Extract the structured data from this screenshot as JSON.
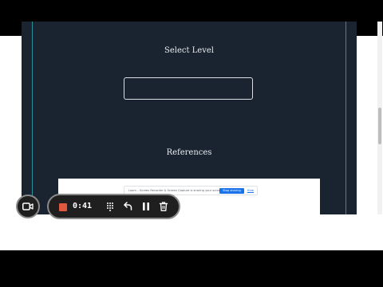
{
  "page": {
    "select_level_label": "Select Level",
    "level_input_value": "",
    "references_label": "References"
  },
  "notice": {
    "text": "Loom – Screen Recorder & Screen Capture is sharing your screen.",
    "stop_label": "Stop sharing",
    "hide_label": "Hide"
  },
  "recorder": {
    "timer": "0:41",
    "icons": [
      "camera-icon",
      "stop-icon",
      "draw-icon",
      "undo-icon",
      "pause-icon",
      "trash-icon"
    ]
  },
  "colors": {
    "page_bg": "#1a2430",
    "rail": "#2a8f9a",
    "stop": "#e2583e",
    "notice_button": "#1a73e8"
  }
}
